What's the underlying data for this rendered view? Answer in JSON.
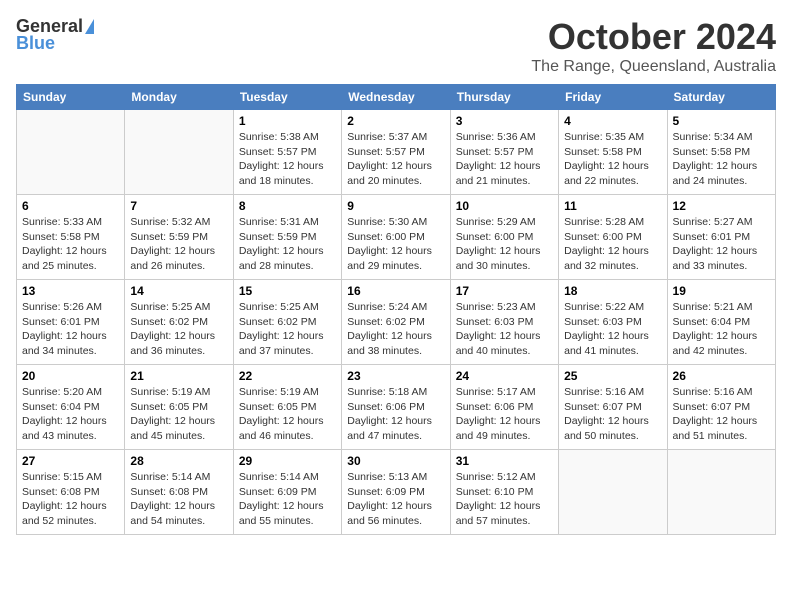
{
  "header": {
    "logo_general": "General",
    "logo_blue": "Blue",
    "month_title": "October 2024",
    "subtitle": "The Range, Queensland, Australia"
  },
  "days_of_week": [
    "Sunday",
    "Monday",
    "Tuesday",
    "Wednesday",
    "Thursday",
    "Friday",
    "Saturday"
  ],
  "weeks": [
    [
      {
        "day": "",
        "info": ""
      },
      {
        "day": "",
        "info": ""
      },
      {
        "day": "1",
        "info": "Sunrise: 5:38 AM\nSunset: 5:57 PM\nDaylight: 12 hours\nand 18 minutes."
      },
      {
        "day": "2",
        "info": "Sunrise: 5:37 AM\nSunset: 5:57 PM\nDaylight: 12 hours\nand 20 minutes."
      },
      {
        "day": "3",
        "info": "Sunrise: 5:36 AM\nSunset: 5:57 PM\nDaylight: 12 hours\nand 21 minutes."
      },
      {
        "day": "4",
        "info": "Sunrise: 5:35 AM\nSunset: 5:58 PM\nDaylight: 12 hours\nand 22 minutes."
      },
      {
        "day": "5",
        "info": "Sunrise: 5:34 AM\nSunset: 5:58 PM\nDaylight: 12 hours\nand 24 minutes."
      }
    ],
    [
      {
        "day": "6",
        "info": "Sunrise: 5:33 AM\nSunset: 5:58 PM\nDaylight: 12 hours\nand 25 minutes."
      },
      {
        "day": "7",
        "info": "Sunrise: 5:32 AM\nSunset: 5:59 PM\nDaylight: 12 hours\nand 26 minutes."
      },
      {
        "day": "8",
        "info": "Sunrise: 5:31 AM\nSunset: 5:59 PM\nDaylight: 12 hours\nand 28 minutes."
      },
      {
        "day": "9",
        "info": "Sunrise: 5:30 AM\nSunset: 6:00 PM\nDaylight: 12 hours\nand 29 minutes."
      },
      {
        "day": "10",
        "info": "Sunrise: 5:29 AM\nSunset: 6:00 PM\nDaylight: 12 hours\nand 30 minutes."
      },
      {
        "day": "11",
        "info": "Sunrise: 5:28 AM\nSunset: 6:00 PM\nDaylight: 12 hours\nand 32 minutes."
      },
      {
        "day": "12",
        "info": "Sunrise: 5:27 AM\nSunset: 6:01 PM\nDaylight: 12 hours\nand 33 minutes."
      }
    ],
    [
      {
        "day": "13",
        "info": "Sunrise: 5:26 AM\nSunset: 6:01 PM\nDaylight: 12 hours\nand 34 minutes."
      },
      {
        "day": "14",
        "info": "Sunrise: 5:25 AM\nSunset: 6:02 PM\nDaylight: 12 hours\nand 36 minutes."
      },
      {
        "day": "15",
        "info": "Sunrise: 5:25 AM\nSunset: 6:02 PM\nDaylight: 12 hours\nand 37 minutes."
      },
      {
        "day": "16",
        "info": "Sunrise: 5:24 AM\nSunset: 6:02 PM\nDaylight: 12 hours\nand 38 minutes."
      },
      {
        "day": "17",
        "info": "Sunrise: 5:23 AM\nSunset: 6:03 PM\nDaylight: 12 hours\nand 40 minutes."
      },
      {
        "day": "18",
        "info": "Sunrise: 5:22 AM\nSunset: 6:03 PM\nDaylight: 12 hours\nand 41 minutes."
      },
      {
        "day": "19",
        "info": "Sunrise: 5:21 AM\nSunset: 6:04 PM\nDaylight: 12 hours\nand 42 minutes."
      }
    ],
    [
      {
        "day": "20",
        "info": "Sunrise: 5:20 AM\nSunset: 6:04 PM\nDaylight: 12 hours\nand 43 minutes."
      },
      {
        "day": "21",
        "info": "Sunrise: 5:19 AM\nSunset: 6:05 PM\nDaylight: 12 hours\nand 45 minutes."
      },
      {
        "day": "22",
        "info": "Sunrise: 5:19 AM\nSunset: 6:05 PM\nDaylight: 12 hours\nand 46 minutes."
      },
      {
        "day": "23",
        "info": "Sunrise: 5:18 AM\nSunset: 6:06 PM\nDaylight: 12 hours\nand 47 minutes."
      },
      {
        "day": "24",
        "info": "Sunrise: 5:17 AM\nSunset: 6:06 PM\nDaylight: 12 hours\nand 49 minutes."
      },
      {
        "day": "25",
        "info": "Sunrise: 5:16 AM\nSunset: 6:07 PM\nDaylight: 12 hours\nand 50 minutes."
      },
      {
        "day": "26",
        "info": "Sunrise: 5:16 AM\nSunset: 6:07 PM\nDaylight: 12 hours\nand 51 minutes."
      }
    ],
    [
      {
        "day": "27",
        "info": "Sunrise: 5:15 AM\nSunset: 6:08 PM\nDaylight: 12 hours\nand 52 minutes."
      },
      {
        "day": "28",
        "info": "Sunrise: 5:14 AM\nSunset: 6:08 PM\nDaylight: 12 hours\nand 54 minutes."
      },
      {
        "day": "29",
        "info": "Sunrise: 5:14 AM\nSunset: 6:09 PM\nDaylight: 12 hours\nand 55 minutes."
      },
      {
        "day": "30",
        "info": "Sunrise: 5:13 AM\nSunset: 6:09 PM\nDaylight: 12 hours\nand 56 minutes."
      },
      {
        "day": "31",
        "info": "Sunrise: 5:12 AM\nSunset: 6:10 PM\nDaylight: 12 hours\nand 57 minutes."
      },
      {
        "day": "",
        "info": ""
      },
      {
        "day": "",
        "info": ""
      }
    ]
  ]
}
